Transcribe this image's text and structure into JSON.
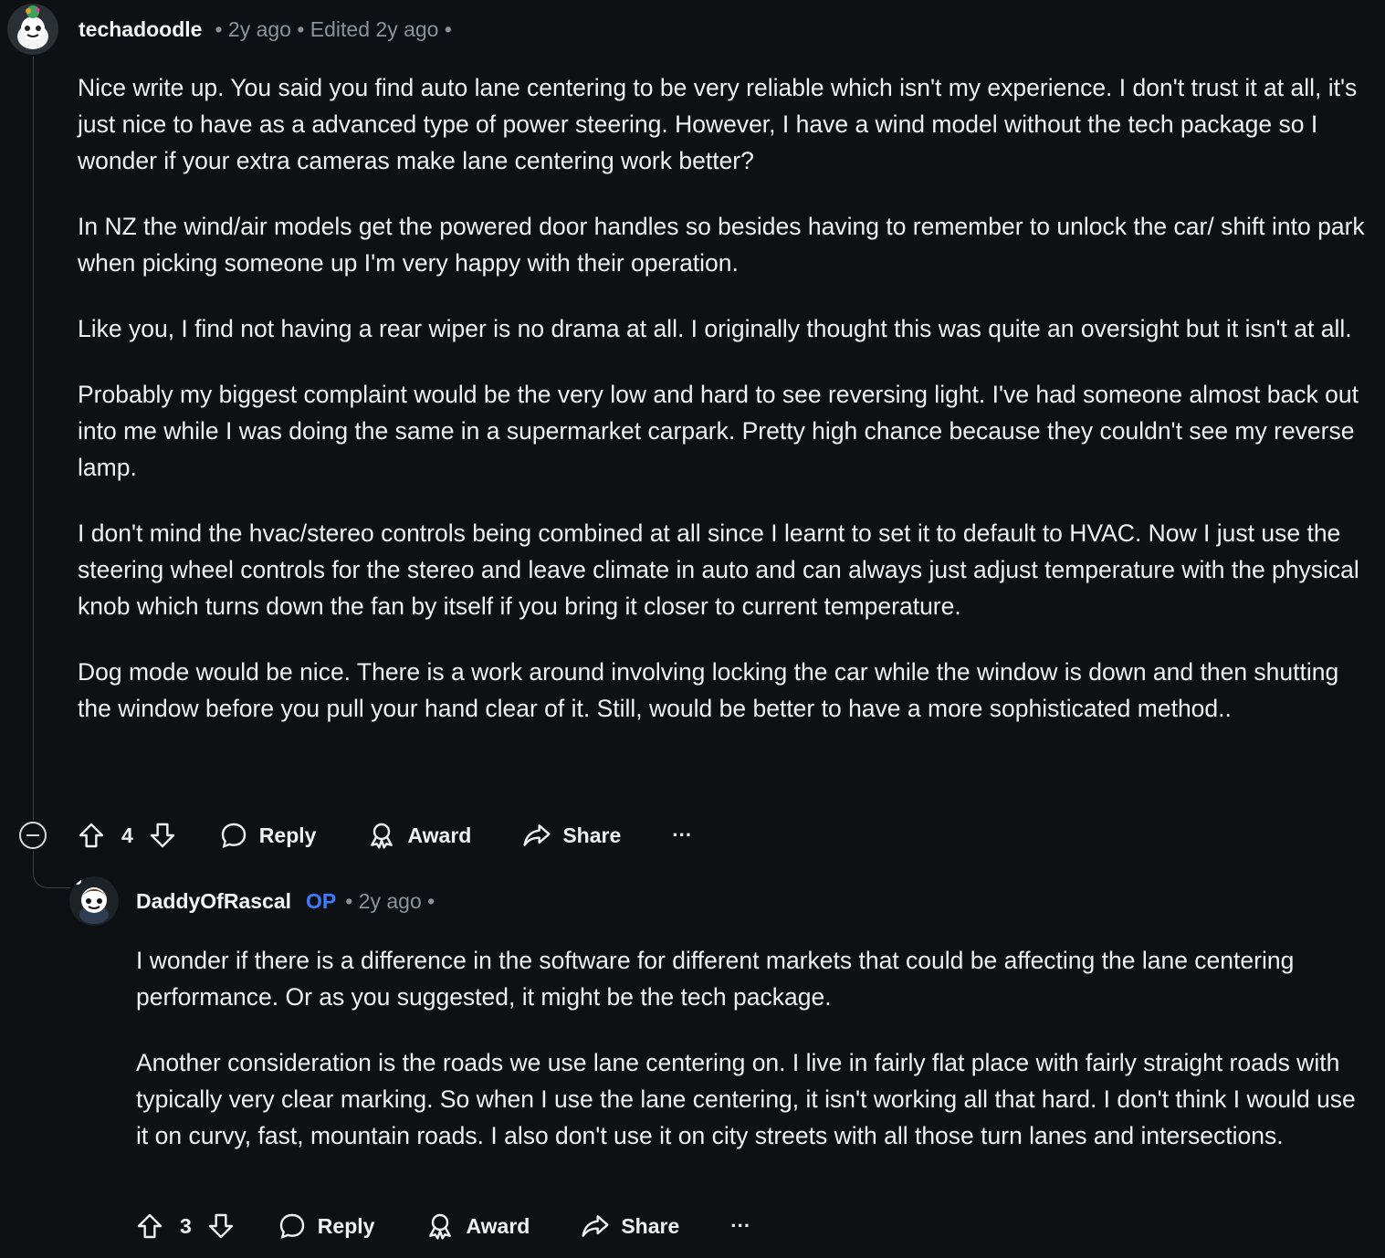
{
  "comment1": {
    "username": "techadoodle",
    "meta": "• 2y ago • Edited 2y ago •",
    "paragraphs": [
      "Nice write up. You said you find auto lane centering to be very reliable which isn't my experience. I don't trust it at all, it's just nice to have as a advanced type of power steering. However, I have a wind model without the tech package so I wonder if your extra cameras make lane centering work better?",
      "In NZ the wind/air models get the powered door handles so besides having to remember to unlock the car/ shift into park when picking someone up I'm very happy with their operation.",
      "Like you, I find not having a rear wiper is no drama at all. I originally thought this was quite an oversight but it isn't at all.",
      "Probably my biggest complaint would be the very low and hard to see reversing light. I've had someone almost back out into me while I was doing the same in a supermarket carpark. Pretty high chance because they couldn't see my reverse lamp.",
      "I don't mind the hvac/stereo controls being combined at all since I learnt to set it to default to HVAC. Now I just use the steering wheel controls for the stereo and leave climate in auto and can always just adjust temperature with the physical knob which turns down the fan by itself if you bring it closer to current temperature.",
      "Dog mode would be nice. There is a work around involving locking the car while the window is down and then shutting the window before you pull your hand clear of it. Still, would be better to have a more sophisticated method.."
    ],
    "score": "4",
    "reply_label": "Reply",
    "award_label": "Award",
    "share_label": "Share",
    "more_label": "···"
  },
  "comment2": {
    "username": "DaddyOfRascal",
    "op_badge": "OP",
    "meta": "• 2y ago •",
    "paragraphs": [
      "I wonder if there is a difference in the software for different markets that could be affecting the lane centering performance. Or as you suggested, it might be the tech package.",
      "Another consideration is the roads we use lane centering on. I live in fairly flat place with fairly straight roads with typically very clear marking. So when I use the lane centering, it isn't working all that hard. I don't think I would use it on curvy, fast, mountain roads. I also don't use it on city streets with all those turn lanes and intersections."
    ],
    "score": "3",
    "reply_label": "Reply",
    "award_label": "Award",
    "share_label": "Share",
    "more_label": "···"
  },
  "colors": {
    "background": "#0e1113",
    "text": "#eef1f3",
    "meta": "#8a9399",
    "op": "#3d7bff",
    "thread_line": "#3a4146"
  }
}
